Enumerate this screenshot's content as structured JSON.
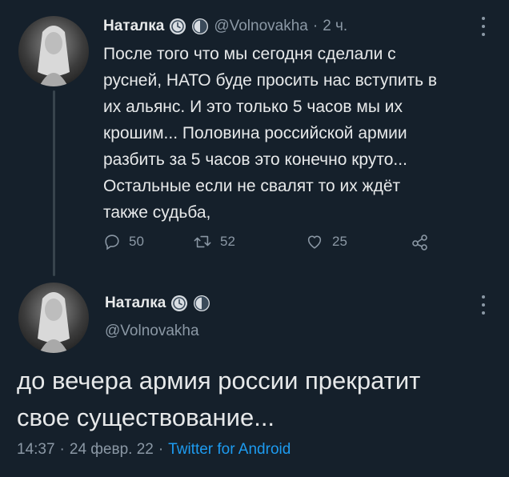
{
  "tweet1": {
    "author_name": "Наталка",
    "handle": "@Volnovakha",
    "separator": "·",
    "time": "2 ч.",
    "text": "После того что мы сегодня сделали с\nрусней, НАТО буде просить нас вступить в\nих альянс. И это только 5 часов мы их\nкрошим... Половина российской армии\nразбить за 5 часов это конечно круто...\nОстальные если не свалят то их ждёт\nтакже судьба,",
    "actions": {
      "reply_count": "50",
      "retweet_count": "52",
      "like_count": "25"
    }
  },
  "tweet2": {
    "author_name": "Наталка",
    "handle": "@Volnovakha",
    "text": "до вечера армия россии прекратит\nсвое существование...",
    "time": "14:37",
    "dot1": "·",
    "date": "24 февр. 22",
    "dot2": "·",
    "source": "Twitter for Android"
  },
  "icons": {
    "badges": [
      "clock-badge-icon",
      "clock-badge-icon"
    ],
    "actions": [
      "reply-icon",
      "retweet-icon",
      "like-icon",
      "share-icon"
    ],
    "menu": "more-icon"
  },
  "colors": {
    "background": "#15202b",
    "text": "#e7e9ea",
    "muted": "#8b98a5",
    "link": "#1d9bf0"
  }
}
